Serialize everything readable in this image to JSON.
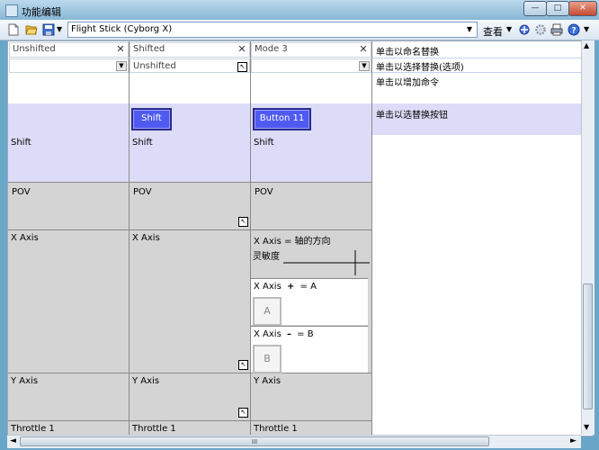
{
  "window": {
    "title": "功能编辑",
    "min_glyph": "—",
    "max_glyph": "□",
    "close_glyph": "✕"
  },
  "toolbar": {
    "device_combo_value": "Flight Stick (Cyborg X)",
    "view_label": "查看",
    "combo_arrow": "▼",
    "menu_arrow": "▼"
  },
  "columns": [
    {
      "mode_name": "Unshifted",
      "clear_glyph": "✕",
      "dropdown_value": ""
    },
    {
      "mode_name": "Shifted",
      "clear_glyph": "✕",
      "dropdown_value": "Unshifted"
    },
    {
      "mode_name": "Mode 3",
      "clear_glyph": "✕",
      "dropdown_value": ""
    }
  ],
  "buttons": {
    "col2": "Shift",
    "col3": "Button 11"
  },
  "hints": {
    "rename": "单击以命名替换",
    "choose": "单击以选择替换(选项)",
    "add_command": "单击以增加命令",
    "choose_button": "单击以选替换按钮"
  },
  "rows": {
    "shift": [
      "Shift",
      "Shift",
      "Shift"
    ],
    "pov": [
      "POV",
      "POV",
      "POV"
    ],
    "xaxis": [
      "X Axis",
      "X Axis",
      "X Axis"
    ],
    "yaxis": [
      "Y Axis",
      "Y Axis",
      "Y Axis"
    ],
    "throttle": [
      "Throttle 1",
      "Throttle 1",
      "Throttle 1"
    ]
  },
  "xaxis_details": {
    "direction_suffix": "= 轴的方向",
    "sensitivity_label": "灵敏度",
    "plus_label": "X Axis",
    "plus_sign": "+",
    "plus_value": "= A",
    "plus_key": "A",
    "minus_label": "X Axis",
    "minus_sign": "–",
    "minus_value": "= B",
    "minus_key": "B"
  },
  "scrollbar": {
    "grip": "III",
    "up": "▲",
    "down": "▼",
    "left": "◄",
    "right": "►"
  },
  "colors": {
    "lavender": "#dcdcf8",
    "gray": "#d4d4d4",
    "button_blue": "#4f5af0"
  }
}
